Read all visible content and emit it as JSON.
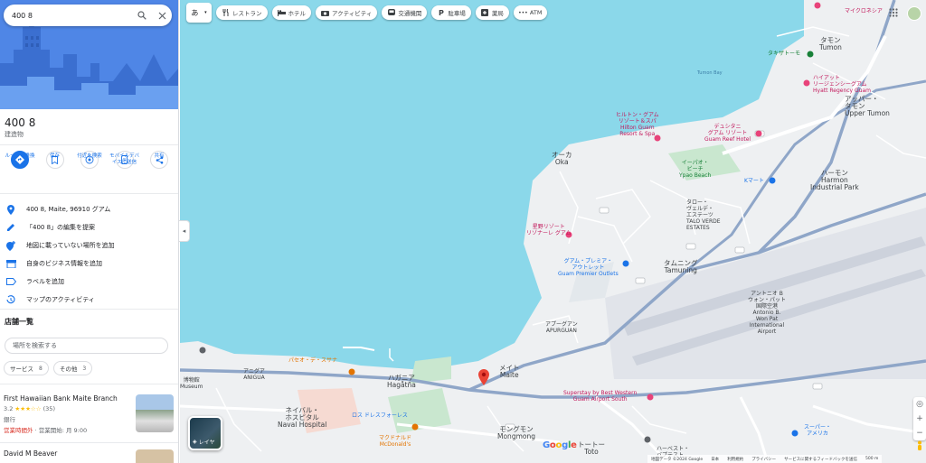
{
  "search": {
    "query": "400 8"
  },
  "place": {
    "title": "400 8",
    "type": "建造物"
  },
  "actions": [
    {
      "label": "ルート・乗換",
      "icon": "directions-icon"
    },
    {
      "label": "保存",
      "icon": "bookmark-icon"
    },
    {
      "label": "付近を検索",
      "icon": "nearby-icon"
    },
    {
      "label": "モバイルデバ\nイスに送信",
      "icon": "send-to-phone-icon"
    },
    {
      "label": "共有",
      "icon": "share-icon"
    }
  ],
  "info_rows": [
    {
      "text": "400 8, Maite, 96910 グアム",
      "icon": "location-pin-icon"
    },
    {
      "text": "「400 8」の編集を提案",
      "icon": "edit-pencil-icon"
    },
    {
      "text": "地図に載っていない場所を追加",
      "icon": "add-place-icon"
    },
    {
      "text": "自身のビジネス情報を追加",
      "icon": "business-icon"
    },
    {
      "text": "ラベルを追加",
      "icon": "label-icon"
    },
    {
      "text": "マップのアクティビティ",
      "icon": "history-icon"
    }
  ],
  "nearby": {
    "title": "店舗一覧",
    "search_placeholder": "場所を検索する",
    "chips": [
      {
        "label": "サービス",
        "count": "8"
      },
      {
        "label": "その他",
        "count": "3"
      }
    ],
    "businesses": [
      {
        "name": "First Hawaiian Bank Maite Branch",
        "rating": "3.2",
        "stars": "★★★☆☆",
        "reviews": "(35)",
        "type": "銀行",
        "status": "営業時間外",
        "hours": " · 営業開始: 月 9:00"
      },
      {
        "name": "David M Beaver"
      }
    ]
  },
  "filters": {
    "lang": "あ",
    "chips": [
      {
        "label": "レストラン",
        "icon": "restaurant-icon"
      },
      {
        "label": "ホテル",
        "icon": "hotel-icon"
      },
      {
        "label": "アクティビティ",
        "icon": "camera-icon"
      },
      {
        "label": "交通機関",
        "icon": "transit-icon"
      },
      {
        "label": "駐車場",
        "icon": "parking-icon"
      },
      {
        "label": "薬局",
        "icon": "pharmacy-icon"
      },
      {
        "label": "ATM",
        "icon": "atm-icon"
      }
    ]
  },
  "map_labels": {
    "micronesia_mall": "マイクロネシア",
    "tamon": "タモン\nTumon",
    "tumon_bay": "Tumon Bay",
    "takayama": "タキザトーモ",
    "hyatt": "ハイアット\nリージェンシーグアム\nHyatt Regency Guam",
    "upper_tumon": "アッパー・\nタモン\nUpper Tumon",
    "hilton": "ヒルトン・グアム\nリゾート＆スパ\nHilton Guam\nResort & Spa",
    "dusit": "デュシタニ\nグアム リゾート\nGuam Reef Hotel",
    "ipao": "イーパオ・\nビーチ\nYpao Beach",
    "oka": "オーカ\nOka",
    "harmon": "ハーモン\nHarmon\nIndustrial Park",
    "kmart": "Kマート",
    "talo_verde": "タロー・\nヴェルデ・\nエステーツ\nTALO VERDE\nESTATES",
    "hoshino": "星野リゾート\nリゾナーレ グアム",
    "guam_premier": "グアム・プレミア・\nアウトレット\nGuam Premier Outlets",
    "tamuning": "タムニング\nTamuning",
    "airport": "アントニオ B\nウォン・パット\n国際空港\nAntonio B.\nWon Pat\nInternational\nAirport",
    "apurguan": "アプーグアン\nAPURGUAN",
    "meitei": "メイト\nMaite",
    "hagatna": "ハガニア\nHagåtña",
    "anigua": "アニグア\nANIGUA",
    "naval": "ネイバル・\nホスピタル\nNaval Hospital",
    "ross": "ロス ドレスフォーレス",
    "mcdonalds": "マクドナルド\nMcDonald's",
    "mongmong": "モングモン\nMongmong",
    "toto": "トートー\nToto",
    "super": "スーパー・\nアメリカ",
    "harvest": "ハーベスト・\nバプテスト…",
    "museum": "博物館\nMuseum",
    "paseo": "パセオ・デ・スサナ",
    "superstay": "Superstay by Best Western\nGuam Airport South"
  },
  "layers_label": "レイヤ",
  "google_logo": "Google",
  "footer": [
    "地図データ ©2024 Google",
    "日本",
    "利用規約",
    "プライバシー",
    "サービスに関するフィードバックを送信",
    "500 m"
  ]
}
